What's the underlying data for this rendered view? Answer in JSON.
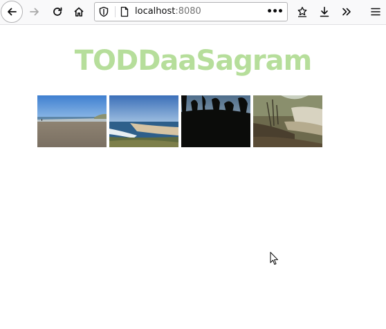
{
  "browser": {
    "url_host": "localhost",
    "url_port": ":8080",
    "more_label": "•••"
  },
  "page": {
    "logo_text": "TODDaaSagram",
    "logo_color": "#b6de9b"
  },
  "gallery": {
    "photos": [
      {
        "name": "beach-photo-1"
      },
      {
        "name": "coast-photo-2"
      },
      {
        "name": "forest-silhouette-photo-3"
      },
      {
        "name": "creek-photo-4"
      }
    ]
  }
}
